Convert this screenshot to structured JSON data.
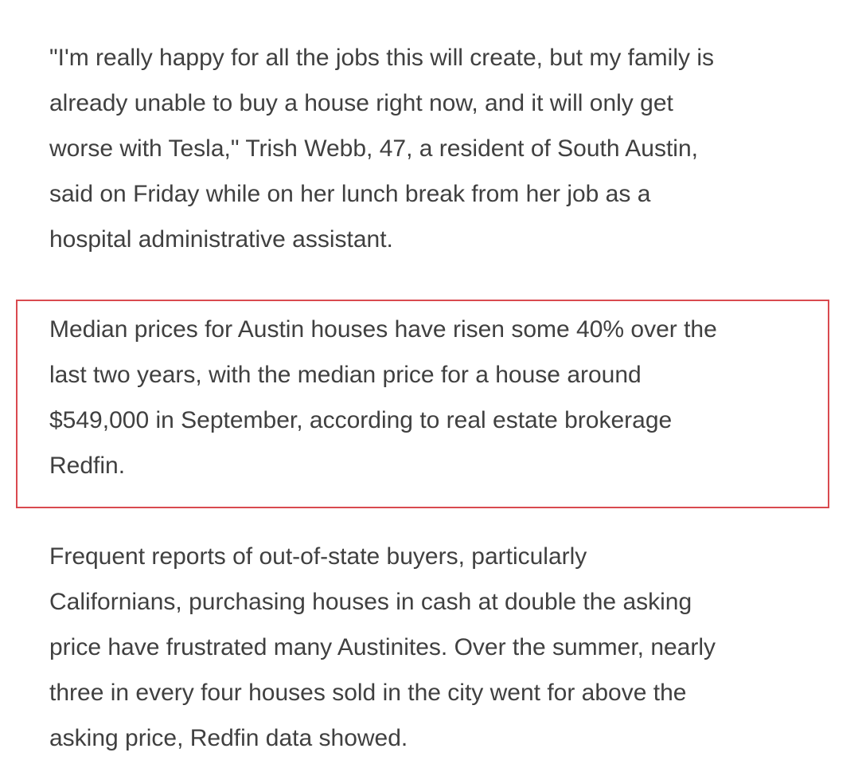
{
  "article": {
    "paragraphs": [
      {
        "lines": [
          "\"I'm really happy for all the jobs this will create, but my family is",
          "already unable to buy a house right now, and it will only get",
          "worse with Tesla,\" Trish Webb, 47, a resident of South Austin,",
          "said on Friday while on her lunch break from her job as a",
          "hospital administrative assistant."
        ]
      },
      {
        "lines": [
          "Median prices for Austin houses have risen some 40% over the",
          "last two years, with the median price for a house around",
          "$549,000 in September, according to real estate brokerage",
          "Redfin."
        ]
      },
      {
        "lines": [
          "Frequent reports of out-of-state buyers, particularly",
          "Californians, purchasing houses in cash at double the asking",
          "price have frustrated many Austinites. Over the summer, nearly",
          "three in every four houses sold in the city went for above the",
          "asking price, Redfin data showed."
        ]
      }
    ]
  },
  "colors": {
    "text": "#404040",
    "highlight_border": "#d94a4f",
    "background": "#ffffff"
  }
}
